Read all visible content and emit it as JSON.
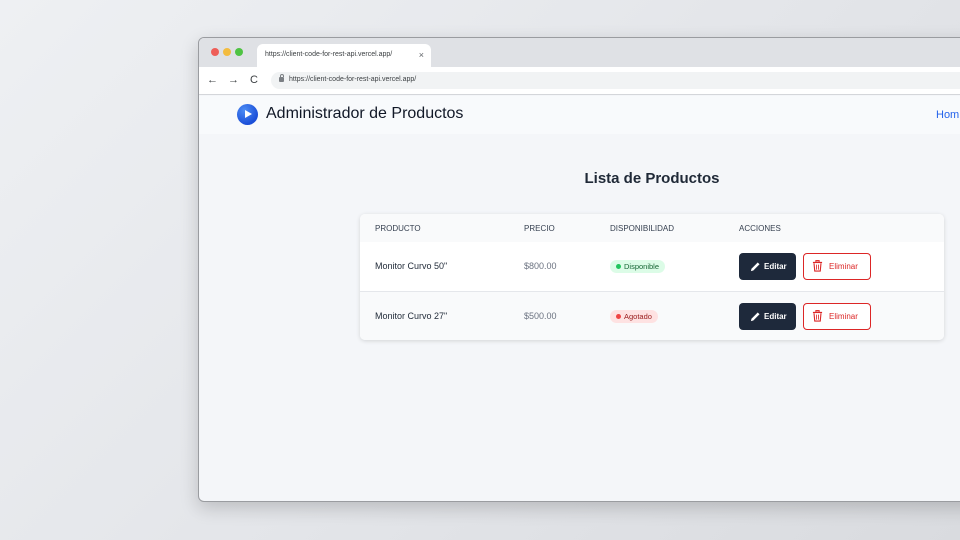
{
  "browser": {
    "tab_title": "https://client-code-for-rest-api.vercel.app/",
    "tab_close": "×",
    "url": "https://client-code-for-rest-api.vercel.app/",
    "back_icon": "←",
    "forward_icon": "→",
    "reload_icon": "C"
  },
  "header": {
    "brand": "Administrador de Productos",
    "nav_home": "Hom"
  },
  "main": {
    "title": "Lista de Productos",
    "columns": [
      "PRODUCTO",
      "PRECIO",
      "DISPONIBILIDAD",
      "ACCIONES"
    ],
    "rows": [
      {
        "name": "Monitor Curvo 50\"",
        "price": "$800.00",
        "status": "Disponible",
        "edit": "Editar",
        "delete": "Eliminar"
      },
      {
        "name": "Monitor Curvo 27\"",
        "price": "$500.00",
        "status": "Agotado",
        "edit": "Editar",
        "delete": "Eliminar"
      }
    ]
  },
  "colors": {
    "accent": "#2563eb",
    "edit_button": "#1e293b",
    "delete_button": "#dc2626",
    "available": "#22c55e",
    "sold_out": "#ef4444"
  }
}
